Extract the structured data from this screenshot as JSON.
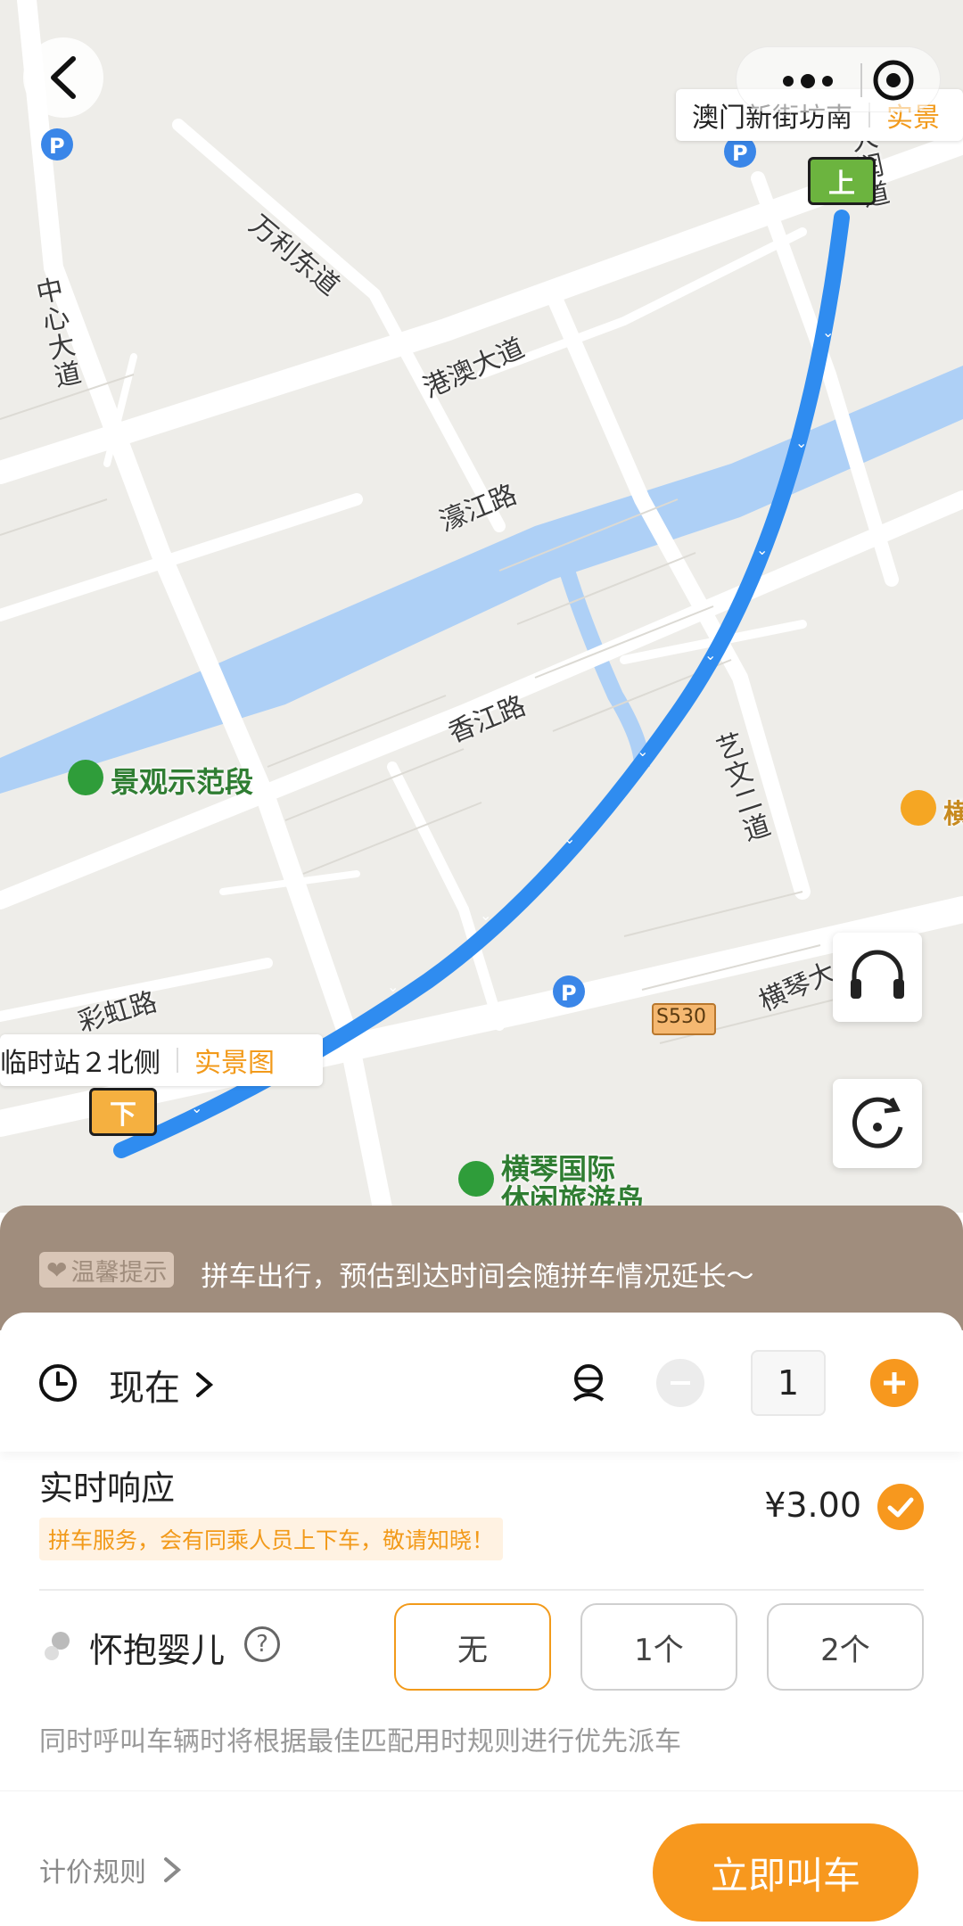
{
  "map": {
    "roads": [
      "万利东道",
      "中心大道",
      "港澳大道",
      "濠江路",
      "香江路",
      "艺文二道",
      "彩虹路",
      "横琴大",
      "大润道"
    ],
    "pois": {
      "scenic": "景观示范段",
      "island_line1": "横琴国际",
      "island_line2": "休闲旅游岛",
      "right_edge": "横",
      "highway": "S530"
    },
    "pickup": {
      "name": "澳门新街坊南",
      "live_view": "实景",
      "pin": "上"
    },
    "dropoff": {
      "name": "临时站２北侧",
      "live_view": "实景图",
      "pin": "下"
    }
  },
  "tip": {
    "badge": "温馨提示",
    "text": "拼车出行，预估到达时间会随拼车情况延长～"
  },
  "booking": {
    "time": "现在",
    "passengers": "1"
  },
  "service": {
    "name": "实时响应",
    "note": "拼车服务，会有同乘人员上下车，敬请知晓！",
    "price": "¥3.00"
  },
  "infant": {
    "label": "怀抱婴儿",
    "options": [
      "无",
      "1个",
      "2个"
    ],
    "selected": "无"
  },
  "dispatch_note": "同时呼叫车辆时将根据最佳匹配用时规则进行优先派车",
  "footer": {
    "pricing_rules": "计价规则",
    "call_button": "立即叫车"
  },
  "colors": {
    "accent": "#F7981E",
    "route": "#2F8CF0",
    "tip_bg": "#A08D7D"
  }
}
